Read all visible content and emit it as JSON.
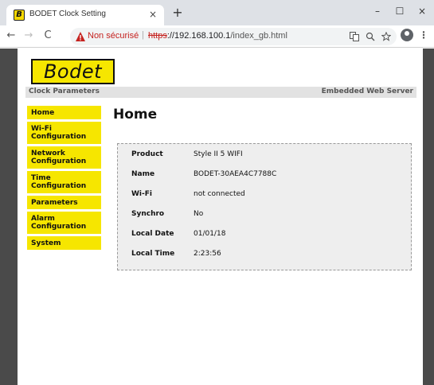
{
  "browser": {
    "tab_title": "BODET Clock Setting",
    "tab_close": "×",
    "new_tab": "+",
    "favicon_letter": "B",
    "window_controls": {
      "minimize": "–",
      "maximize": "☐",
      "close": "×"
    },
    "nav": {
      "back": "←",
      "forward": "→",
      "reload": "C"
    },
    "security_label": "Non sécurisé",
    "separator": "|",
    "url_scheme": "https",
    "url_host": "://192.168.100.1",
    "url_path": "/index_gb.html",
    "omnibox_icons": [
      "translate-icon",
      "zoom-icon",
      "star-icon"
    ],
    "menu_dots": "⋮"
  },
  "page": {
    "logo_text": "Bodet",
    "header_left": "Clock Parameters",
    "header_right": "Embedded Web Server",
    "title": "Home",
    "menu": [
      {
        "label": "Home"
      },
      {
        "label": "Wi-Fi Configuration"
      },
      {
        "label": "Network Configuration"
      },
      {
        "label": "Time Configuration"
      },
      {
        "label": "Parameters"
      },
      {
        "label": "Alarm Configuration"
      },
      {
        "label": "System"
      }
    ],
    "info": [
      {
        "label": "Product",
        "value": "Style II 5 WIFI"
      },
      {
        "label": "Name",
        "value": "BODET-30AEA4C7788C"
      },
      {
        "label": "Wi-Fi",
        "value": "not connected"
      },
      {
        "label": "Synchro",
        "value": "No"
      },
      {
        "label": "Local Date",
        "value": "01/01/18"
      },
      {
        "label": "Local Time",
        "value": "2:23:56"
      }
    ]
  },
  "colors": {
    "brand_yellow": "#f6e600",
    "frame_gray": "#4a4a4a",
    "insecure_red": "#c5221f"
  }
}
